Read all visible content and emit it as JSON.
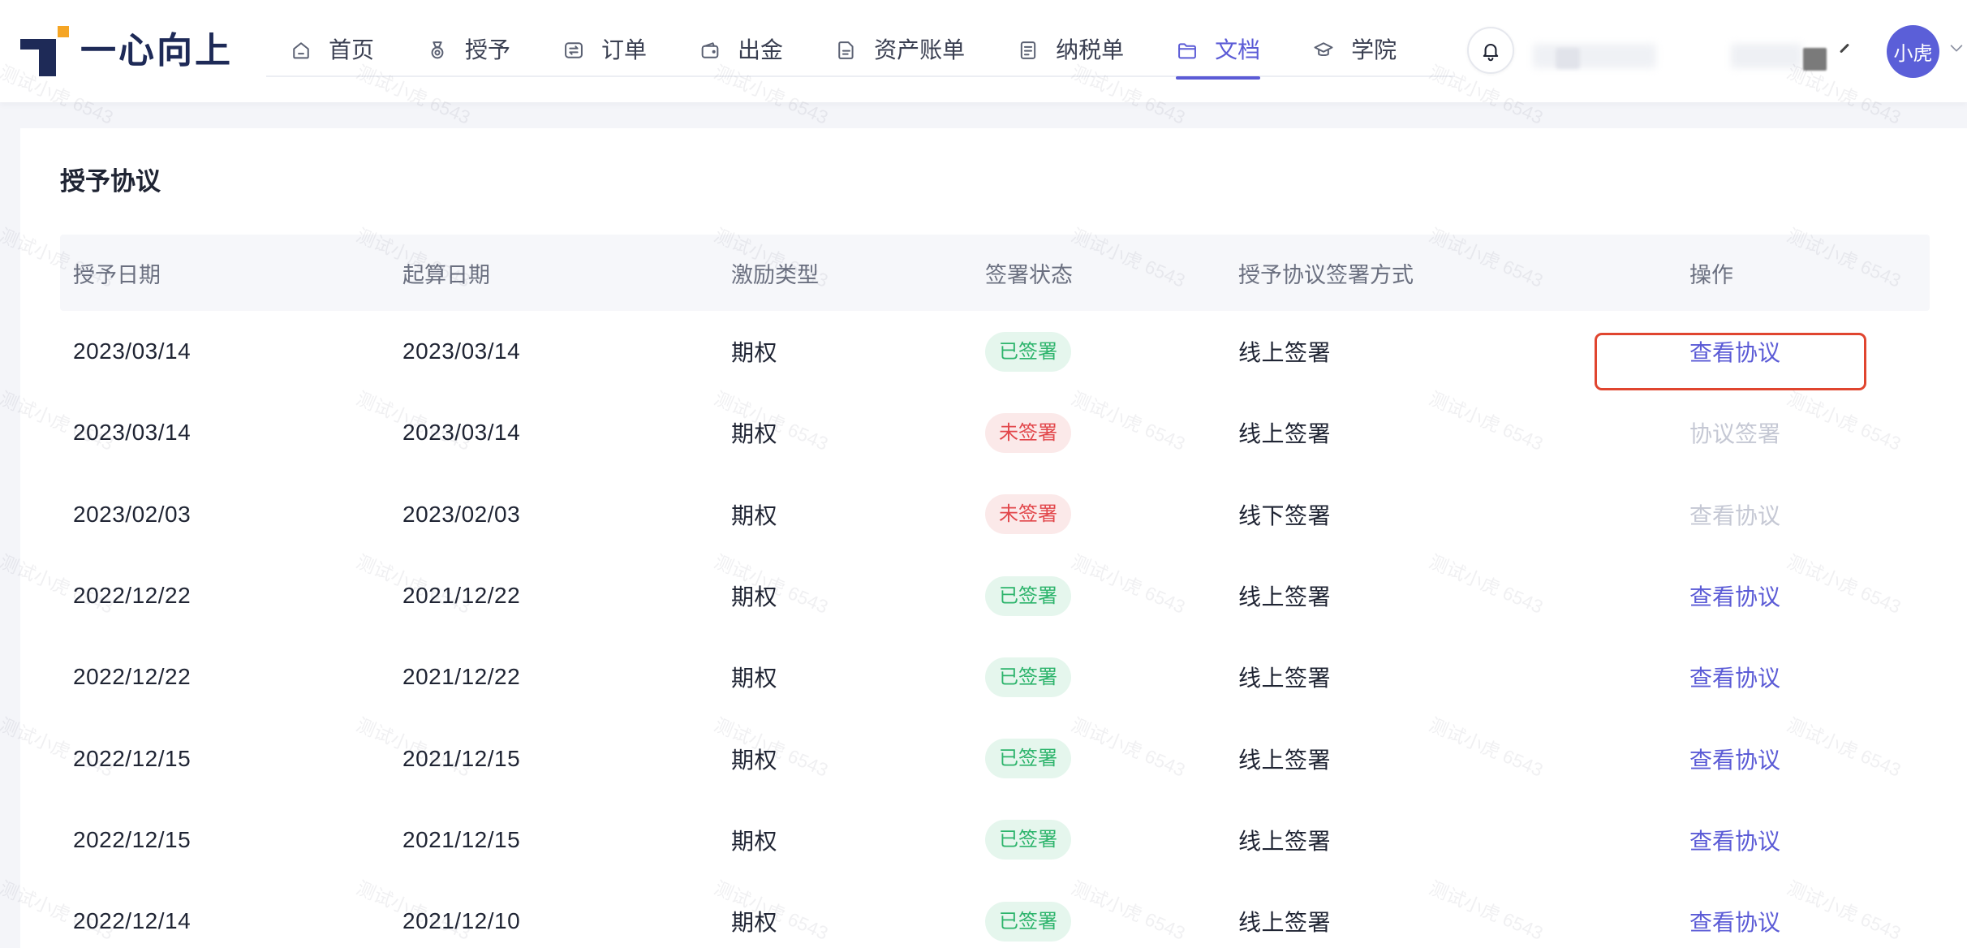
{
  "app": {
    "logo_text": "一心向上",
    "logo_icon": "brand-mark-icon",
    "colors": {
      "accent": "#5b5bd6",
      "brand_navy": "#1e2a57",
      "brand_orange": "#f5a524",
      "text_primary": "#1f2433",
      "text_secondary": "#6b7080",
      "disabled": "#c5c8d4",
      "highlight_border": "#e0452f",
      "avatar_bg": "#5b5fd8"
    }
  },
  "nav": {
    "active": "文档",
    "items": [
      {
        "label": "首页",
        "icon": "home-icon"
      },
      {
        "label": "授予",
        "icon": "medal-icon"
      },
      {
        "label": "订单",
        "icon": "transfer-icon"
      },
      {
        "label": "出金",
        "icon": "wallet-icon"
      },
      {
        "label": "资产账单",
        "icon": "bill-icon"
      },
      {
        "label": "纳税单",
        "icon": "tax-form-icon"
      },
      {
        "label": "文档",
        "icon": "folder-icon"
      },
      {
        "label": "学院",
        "icon": "graduation-cap-icon"
      }
    ]
  },
  "header": {
    "notification_icon": "bell-icon",
    "user_menu_icon": "chevron-down-icon"
  },
  "user": {
    "avatar_text": "小虎"
  },
  "page": {
    "title": "授予协议"
  },
  "table": {
    "columns": [
      "授予日期",
      "起算日期",
      "激励类型",
      "签署状态",
      "授予协议签署方式",
      "操作"
    ],
    "rows": [
      {
        "grant_date": "2023/03/14",
        "start_date": "2023/03/14",
        "incentive_type": "期权",
        "sign_status": "已签署",
        "status_color": "#2db46c",
        "sign_method": "线上签署",
        "action": "查看协议",
        "action_enabled": true
      },
      {
        "grant_date": "2023/03/14",
        "start_date": "2023/03/14",
        "incentive_type": "期权",
        "sign_status": "未签署",
        "status_color": "#e2474b",
        "sign_method": "线上签署",
        "action": "协议签署",
        "action_enabled": false
      },
      {
        "grant_date": "2023/02/03",
        "start_date": "2023/02/03",
        "incentive_type": "期权",
        "sign_status": "未签署",
        "status_color": "#e2474b",
        "sign_method": "线下签署",
        "action": "查看协议",
        "action_enabled": false
      },
      {
        "grant_date": "2022/12/22",
        "start_date": "2021/12/22",
        "incentive_type": "期权",
        "sign_status": "已签署",
        "status_color": "#2db46c",
        "sign_method": "线上签署",
        "action": "查看协议",
        "action_enabled": true
      },
      {
        "grant_date": "2022/12/22",
        "start_date": "2021/12/22",
        "incentive_type": "期权",
        "sign_status": "已签署",
        "status_color": "#2db46c",
        "sign_method": "线上签署",
        "action": "查看协议",
        "action_enabled": true
      },
      {
        "grant_date": "2022/12/15",
        "start_date": "2021/12/15",
        "incentive_type": "期权",
        "sign_status": "已签署",
        "status_color": "#2db46c",
        "sign_method": "线上签署",
        "action": "查看协议",
        "action_enabled": true
      },
      {
        "grant_date": "2022/12/15",
        "start_date": "2021/12/15",
        "incentive_type": "期权",
        "sign_status": "已签署",
        "status_color": "#2db46c",
        "sign_method": "线上签署",
        "action": "查看协议",
        "action_enabled": true
      },
      {
        "grant_date": "2022/12/14",
        "start_date": "2021/12/10",
        "incentive_type": "期权",
        "sign_status": "已签署",
        "status_color": "#2db46c",
        "sign_method": "线上签署",
        "action": "查看协议",
        "action_enabled": true
      }
    ]
  },
  "watermark": {
    "text": "测试小虎 6543"
  }
}
